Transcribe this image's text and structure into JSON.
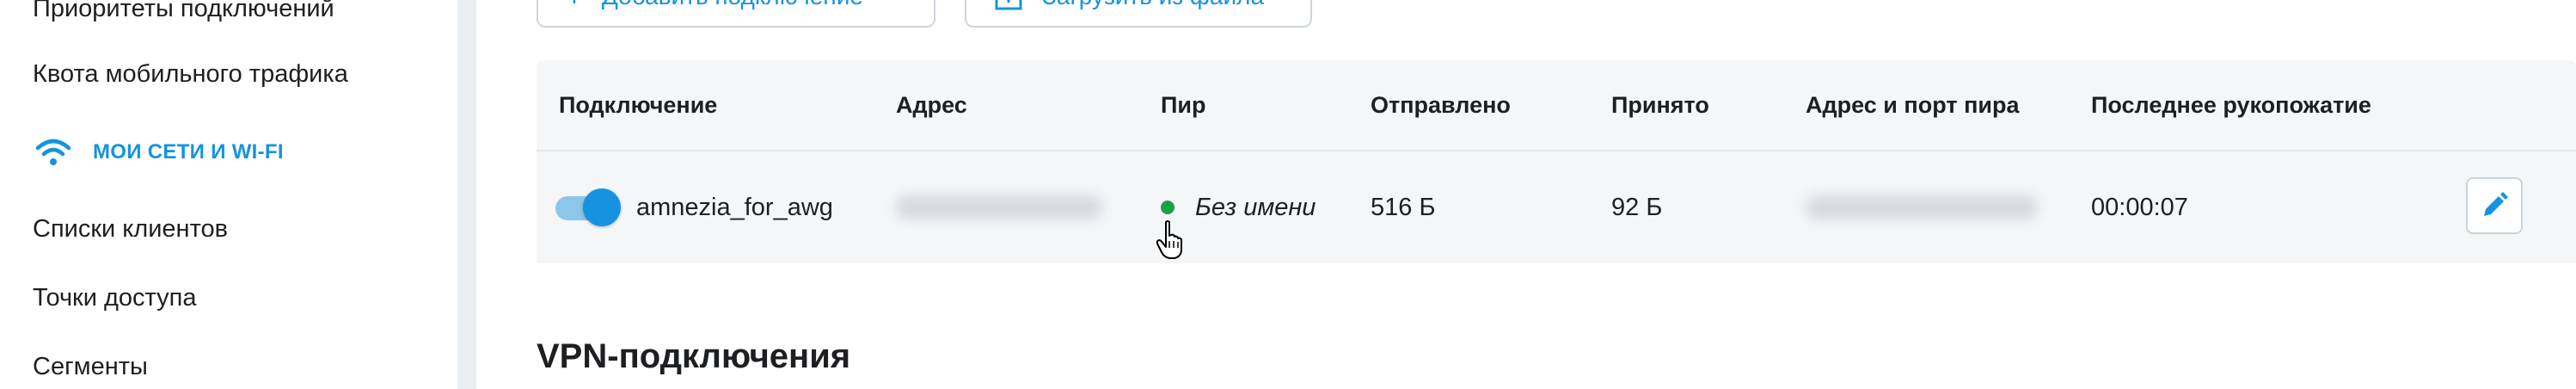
{
  "sidebar": {
    "items": [
      {
        "label": "Приоритеты подключений"
      },
      {
        "label": "Квота мобильного трафика"
      },
      {
        "label": "МОИ СЕТИ И WI-FI",
        "icon": "wifi-icon"
      },
      {
        "label": "Списки клиентов"
      },
      {
        "label": "Точки доступа"
      },
      {
        "label": "Сегменты"
      }
    ]
  },
  "toolbar": {
    "add_label": "Добавить подключение",
    "add_icon": "plus-icon",
    "upload_label": "Загрузить из файла",
    "upload_icon": "upload-icon"
  },
  "table": {
    "headers": [
      "Подключение",
      "Адрес",
      "Пир",
      "Отправлено",
      "Принято",
      "Адрес и порт пира",
      "Последнее рукопожатие"
    ],
    "rows": [
      {
        "enabled": true,
        "connection": "amnezia_for_awg",
        "peer": "Без имени",
        "peer_status": "online",
        "sent": "516 Б",
        "received": "92 Б",
        "handshake": "00:00:07"
      }
    ]
  },
  "section_title": "VPN-подключения",
  "colors": {
    "accent": "#1593e0",
    "status_online": "#1e9e4a",
    "header_bg": "#f4f6f8"
  }
}
